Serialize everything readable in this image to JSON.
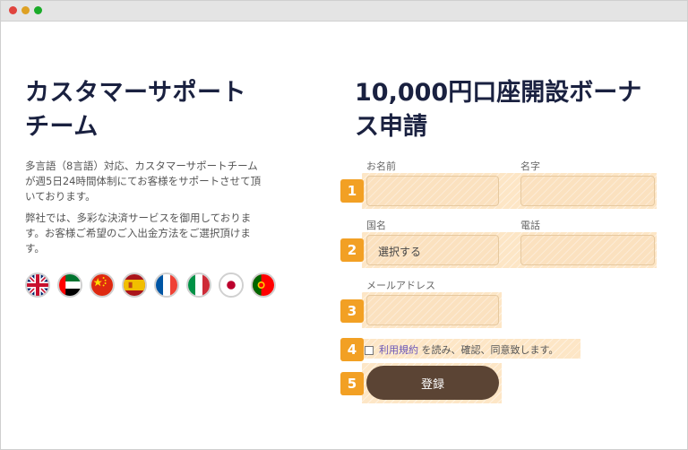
{
  "support": {
    "title_line1": "カスタマーサポート",
    "title_line2": "チーム",
    "desc1_line1": "多言語（8言語）対応、カスタマーサポートチーム",
    "desc1_line2": "が週5日24時間体制にてお客様をサポートさせて頂",
    "desc1_line3": "いております。",
    "desc2_line1": "弊社では、多彩な決済サービスを御用しておりま",
    "desc2_line2": "す。お客様ご希望のご入出金方法をご選択頂けま",
    "desc2_line3": "す。",
    "flags": [
      "uk-flag-icon",
      "uae-flag-icon",
      "china-flag-icon",
      "spain-flag-icon",
      "france-flag-icon",
      "italy-flag-icon",
      "japan-flag-icon",
      "portugal-flag-icon"
    ]
  },
  "form": {
    "title_line1": "10,000円口座開設ボーナ",
    "title_line2": "ス申請",
    "first_name_label": "お名前",
    "last_name_label": "名字",
    "country_label": "国名",
    "country_value": "選択する",
    "phone_label": "電話",
    "email_label": "メールアドレス",
    "terms_link": "利用規約",
    "terms_text": "を読み、確認、同意致します。",
    "submit_label": "登録",
    "badges": [
      "1",
      "2",
      "3",
      "4",
      "5"
    ],
    "highlight_color": "#fde6c6",
    "badge_color": "#f2a024",
    "button_color": "#5b4434"
  }
}
